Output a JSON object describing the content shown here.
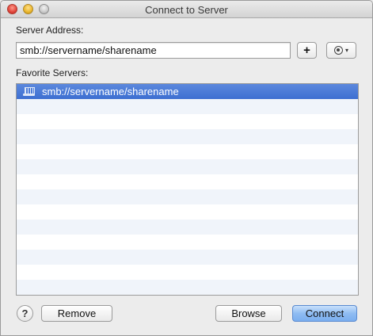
{
  "window": {
    "title": "Connect to Server"
  },
  "labels": {
    "server_address": "Server Address:",
    "favorite_servers": "Favorite Servers:"
  },
  "address_field": {
    "value": "smb://servername/sharename"
  },
  "toolbar": {
    "add_label": "+",
    "action_icon": "gear-icon",
    "action_caret": "▾"
  },
  "favorites": [
    {
      "label": "smb://servername/sharename",
      "selected": true,
      "icon": "server-icon"
    },
    {
      "label": ""
    },
    {
      "label": ""
    },
    {
      "label": ""
    },
    {
      "label": ""
    },
    {
      "label": ""
    },
    {
      "label": ""
    },
    {
      "label": ""
    },
    {
      "label": ""
    },
    {
      "label": ""
    },
    {
      "label": ""
    },
    {
      "label": ""
    },
    {
      "label": ""
    },
    {
      "label": ""
    }
  ],
  "buttons": {
    "help": "?",
    "remove": "Remove",
    "browse": "Browse",
    "connect": "Connect"
  },
  "colors": {
    "selection": "#3d6fd1",
    "primary_button": "#8fbcf2",
    "alt_row": "#f0f4fa"
  }
}
